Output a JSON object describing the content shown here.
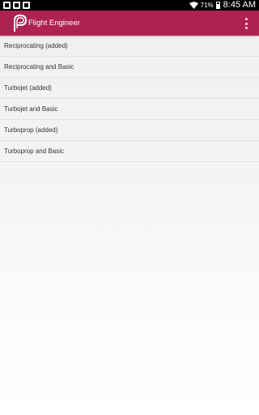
{
  "status_bar": {
    "battery_percent": "71%",
    "battery_level": 0.71,
    "time": "8:45 AM",
    "notification_icons": [
      "image-icon",
      "store-icon",
      "photo-icon"
    ]
  },
  "app_bar": {
    "title": "Flight Engineer",
    "color": "#ae2253",
    "logo_icon": "flight-engineer-logo-icon",
    "menu_icon": "more-vert-icon"
  },
  "list": {
    "items": [
      {
        "label": "Reciprocating (added)"
      },
      {
        "label": "Reciprocating and Basic"
      },
      {
        "label": "Turbojet (added)"
      },
      {
        "label": "Turbojet and Basic"
      },
      {
        "label": "Turboprop (added)"
      },
      {
        "label": "Turboprop and Basic"
      }
    ]
  }
}
